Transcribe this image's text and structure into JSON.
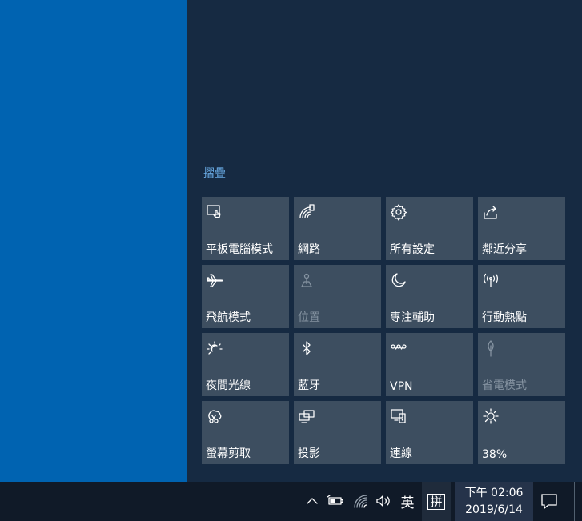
{
  "action_center": {
    "collapse_label": "摺疊",
    "tiles": [
      {
        "label": "平板電腦模式",
        "icon": "tablet-mode-icon",
        "enabled": true
      },
      {
        "label": "網路",
        "icon": "network-icon",
        "enabled": true
      },
      {
        "label": "所有設定",
        "icon": "gear-icon",
        "enabled": true
      },
      {
        "label": "鄰近分享",
        "icon": "share-icon",
        "enabled": true
      },
      {
        "label": "飛航模式",
        "icon": "airplane-icon",
        "enabled": true
      },
      {
        "label": "位置",
        "icon": "location-icon",
        "enabled": false
      },
      {
        "label": "專注輔助",
        "icon": "moon-icon",
        "enabled": true
      },
      {
        "label": "行動熱點",
        "icon": "hotspot-icon",
        "enabled": true
      },
      {
        "label": "夜間光線",
        "icon": "night-light-icon",
        "enabled": true
      },
      {
        "label": "藍牙",
        "icon": "bluetooth-icon",
        "enabled": true
      },
      {
        "label": "VPN",
        "icon": "vpn-icon",
        "enabled": true
      },
      {
        "label": "省電模式",
        "icon": "leaf-icon",
        "enabled": false
      },
      {
        "label": "螢幕剪取",
        "icon": "screen-snip-icon",
        "enabled": true
      },
      {
        "label": "投影",
        "icon": "project-icon",
        "enabled": true
      },
      {
        "label": "連線",
        "icon": "connect-icon",
        "enabled": true
      },
      {
        "label": "38%",
        "icon": "brightness-icon",
        "enabled": true
      }
    ]
  },
  "taskbar": {
    "language": "英",
    "ime": "拼",
    "time": "下午 02:06",
    "date": "2019/6/14",
    "icons": [
      "chevron-up-icon",
      "battery-icon",
      "wifi-icon",
      "volume-icon",
      "notification-icon"
    ]
  },
  "colors": {
    "desktop": "#0063b1",
    "panel": "#162a42",
    "tile": "#3d4e60",
    "link": "#68a9e3",
    "taskbar": "#101a28"
  }
}
